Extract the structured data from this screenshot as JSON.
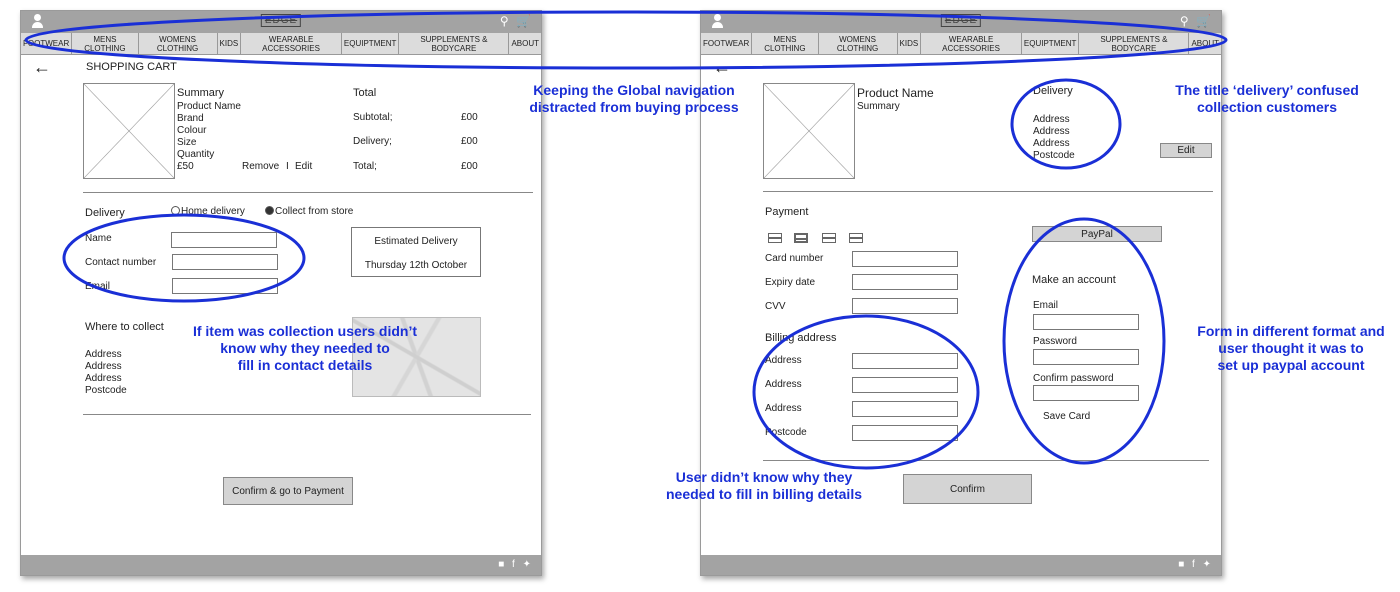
{
  "left": {
    "logo": "EDGE",
    "nav": [
      "FOOTWEAR",
      "MENS CLOTHING",
      "WOMENS CLOTHING",
      "KIDS",
      "WEARABLE ACCESSORIES",
      "EQUIPTMENT",
      "SUPPLEMENTS & BODYCARE",
      "ABOUT"
    ],
    "page_title": "SHOPPING CART",
    "summary": {
      "heading": "Summary",
      "lines": [
        "Product Name",
        "Brand",
        "Colour",
        "Size",
        "Quantity"
      ],
      "price": "£50",
      "remove_label": "Remove",
      "separator": "I",
      "edit_label": "Edit"
    },
    "totals": {
      "heading": "Total",
      "rows": [
        {
          "label": "Subtotal;",
          "value": "£00"
        },
        {
          "label": "Delivery;",
          "value": "£00"
        },
        {
          "label": "Total;",
          "value": "£00"
        }
      ]
    },
    "delivery": {
      "heading": "Delivery",
      "option_home": "Home delivery",
      "option_collect": "Collect from store",
      "fields": [
        "Name",
        "Contact number",
        "Email"
      ]
    },
    "estimated": {
      "title": "Estimated Delivery",
      "date": "Thursday 12th October"
    },
    "collect": {
      "heading": "Where to collect",
      "lines": [
        "Address",
        "Address",
        "Address",
        "Postcode"
      ]
    },
    "confirm_button": "Confirm & go to Payment"
  },
  "right": {
    "logo": "EDGE",
    "nav": [
      "FOOTWEAR",
      "MENS CLOTHING",
      "WOMENS CLOTHING",
      "KIDS",
      "WEARABLE ACCESSORIES",
      "EQUIPTMENT",
      "SUPPLEMENTS & BODYCARE",
      "ABOUT"
    ],
    "product": {
      "name": "Product Name",
      "summary": "Summary"
    },
    "delivery": {
      "heading": "Delivery",
      "lines": [
        "Address",
        "Address",
        "Address",
        "Postcode"
      ]
    },
    "edit_button": "Edit",
    "payment": {
      "heading": "Payment",
      "fields": [
        "Card number",
        "Expiry date",
        "CVV"
      ]
    },
    "billing": {
      "heading": "Billing address",
      "fields": [
        "Address",
        "Address",
        "Address",
        "Postcode"
      ]
    },
    "paypal_button": "PayPal",
    "account": {
      "heading": "Make an account",
      "fields": [
        "Email",
        "Password",
        "Confirm password"
      ],
      "save_card": "Save Card"
    },
    "confirm_button": "Confirm"
  },
  "annotations": {
    "global_nav": [
      "Keeping the Global navigation",
      "distracted from buying process"
    ],
    "delivery_title": [
      "The title ‘delivery’ confused",
      "collection customers"
    ],
    "contact_details": [
      "If item was collection users didn’t",
      "know why they needed to",
      "fill in contact details"
    ],
    "account_form": [
      "Form in different format and",
      "user thought it was to",
      "set up paypal account"
    ],
    "billing": [
      "User didn’t know why they",
      "needed to fill in billing details"
    ]
  },
  "colors": {
    "annotation": "#1a2fd6",
    "bar": "#a3a3a3",
    "nav": "#dcdcdc"
  }
}
